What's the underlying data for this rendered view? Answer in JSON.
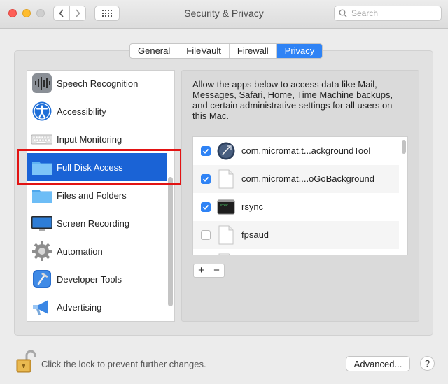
{
  "window": {
    "title": "Security & Privacy"
  },
  "search": {
    "placeholder": "Search"
  },
  "tabs": [
    {
      "label": "General"
    },
    {
      "label": "FileVault"
    },
    {
      "label": "Firewall"
    },
    {
      "label": "Privacy",
      "selected": true
    }
  ],
  "sidebar": {
    "items": [
      {
        "label": "Speech Recognition",
        "icon": "waveform-icon"
      },
      {
        "label": "Accessibility",
        "icon": "accessibility-icon"
      },
      {
        "label": "Input Monitoring",
        "icon": "keyboard-icon"
      },
      {
        "label": "Full Disk Access",
        "icon": "folder-icon",
        "selected": true
      },
      {
        "label": "Files and Folders",
        "icon": "folder-icon"
      },
      {
        "label": "Screen Recording",
        "icon": "display-icon"
      },
      {
        "label": "Automation",
        "icon": "gear-icon"
      },
      {
        "label": "Developer Tools",
        "icon": "hammer-icon"
      },
      {
        "label": "Advertising",
        "icon": "megaphone-icon"
      }
    ]
  },
  "privacy": {
    "description": "Allow the apps below to access data like Mail, Messages, Safari, Home, Time Machine backups, and certain administrative settings for all users on this Mac.",
    "apps": [
      {
        "name": "com.micromat.t...ackgroundTool",
        "checked": true,
        "icon": "app-icon"
      },
      {
        "name": "com.micromat....oGoBackground",
        "checked": true,
        "icon": "document-icon"
      },
      {
        "name": "rsync",
        "checked": true,
        "icon": "terminal-icon"
      },
      {
        "name": "fpsaud",
        "checked": false,
        "icon": "document-icon"
      }
    ],
    "add_label": "+",
    "remove_label": "−"
  },
  "footer": {
    "lock_text": "Click the lock to prevent further changes.",
    "advanced_label": "Advanced...",
    "help_label": "?"
  },
  "colors": {
    "accent": "#2f83f5",
    "selection": "#1a63d6",
    "highlight_border": "#e21313"
  }
}
